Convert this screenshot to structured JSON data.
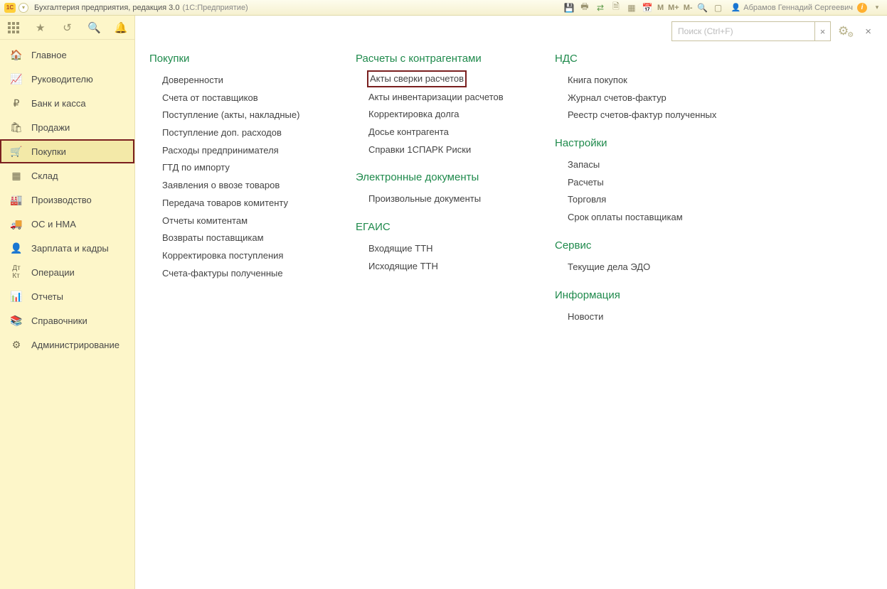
{
  "titlebar": {
    "app_title": "Бухгалтерия предприятия, редакция 3.0",
    "platform": "(1С:Предприятие)",
    "user_name": "Абрамов Геннадий Сергеевич"
  },
  "search": {
    "placeholder": "Поиск (Ctrl+F)"
  },
  "sidebar": {
    "items": [
      {
        "label": "Главное"
      },
      {
        "label": "Руководителю"
      },
      {
        "label": "Банк и касса"
      },
      {
        "label": "Продажи"
      },
      {
        "label": "Покупки"
      },
      {
        "label": "Склад"
      },
      {
        "label": "Производство"
      },
      {
        "label": "ОС и НМА"
      },
      {
        "label": "Зарплата и кадры"
      },
      {
        "label": "Операции"
      },
      {
        "label": "Отчеты"
      },
      {
        "label": "Справочники"
      },
      {
        "label": "Администрирование"
      }
    ]
  },
  "sections": {
    "purchases": {
      "title": "Покупки",
      "items": [
        "Доверенности",
        "Счета от поставщиков",
        "Поступление (акты, накладные)",
        "Поступление доп. расходов",
        "Расходы предпринимателя",
        "ГТД по импорту",
        "Заявления о ввозе товаров",
        "Передача товаров комитенту",
        "Отчеты комитентам",
        "Возвраты поставщикам",
        "Корректировка поступления",
        "Счета-фактуры полученные"
      ]
    },
    "contractors": {
      "title": "Расчеты с контрагентами",
      "items": [
        "Акты сверки расчетов",
        "Акты инвентаризации расчетов",
        "Корректировка долга",
        "Досье контрагента",
        "Справки 1СПАРК Риски"
      ]
    },
    "edocs": {
      "title": "Электронные документы",
      "items": [
        "Произвольные документы"
      ]
    },
    "egais": {
      "title": "ЕГАИС",
      "items": [
        "Входящие ТТН",
        "Исходящие ТТН"
      ]
    },
    "nds": {
      "title": "НДС",
      "items": [
        "Книга покупок",
        "Журнал счетов-фактур",
        "Реестр счетов-фактур полученных"
      ]
    },
    "settings": {
      "title": "Настройки",
      "items": [
        "Запасы",
        "Расчеты",
        "Торговля",
        "Срок оплаты поставщикам"
      ]
    },
    "service": {
      "title": "Сервис",
      "items": [
        "Текущие дела ЭДО"
      ]
    },
    "info": {
      "title": "Информация",
      "items": [
        "Новости"
      ]
    }
  }
}
